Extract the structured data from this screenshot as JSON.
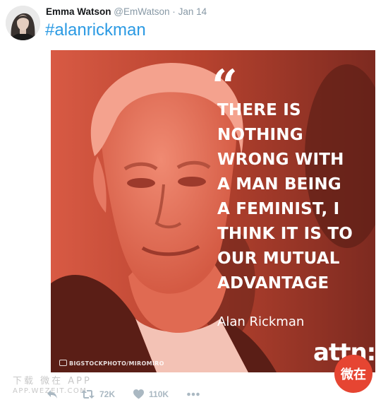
{
  "tweet": {
    "author_name": "Emma Watson",
    "author_handle": "@EmWatson",
    "separator": "·",
    "date": "Jan 14",
    "hashtag": "#alanrickman"
  },
  "media": {
    "quote_lines": [
      "THERE IS",
      "NOTHING",
      "WRONG WITH",
      "A MAN BEING",
      "A FEMINIST, I",
      "THINK IT IS TO",
      "OUR MUTUAL",
      "ADVANTAGE"
    ],
    "attribution": "Alan Rickman",
    "photo_credit": "BIGSTOCKPHOTO/MIROMIRO",
    "brand": "attn:",
    "overlay_color": "#d9553f"
  },
  "actions": {
    "retweets": "72K",
    "likes": "110K"
  },
  "watermark": {
    "line1": "下载 微在 APP",
    "line2": "APP.WEZEIT.COM",
    "badge": "微在"
  },
  "colors": {
    "link": "#2b9ae3",
    "muted": "#8899a6",
    "action": "#aab8c2",
    "badge": "#e64532"
  }
}
